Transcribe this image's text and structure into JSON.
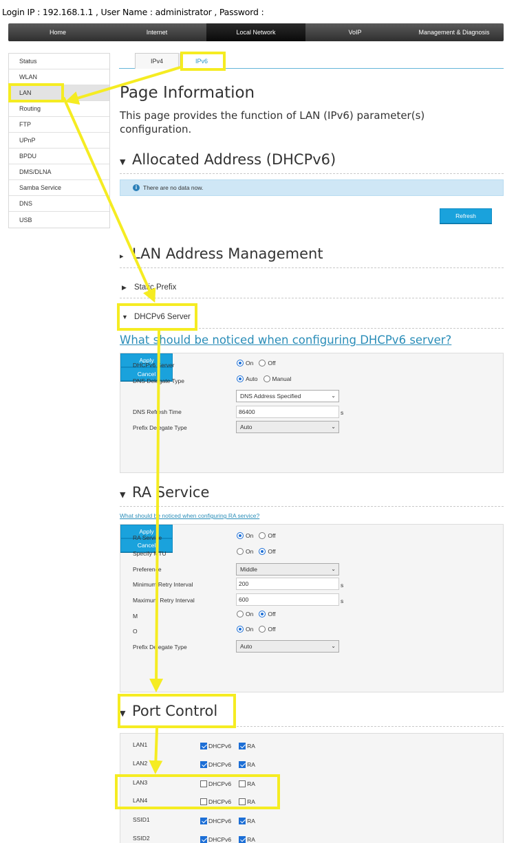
{
  "login_info": "Login IP : 192.168.1.1 ,  User Name : administrator , Password :",
  "topnav": [
    "Home",
    "Internet",
    "Local Network",
    "VoIP",
    "Management & Diagnosis"
  ],
  "topnav_active": "Local Network",
  "sidebar": [
    "Status",
    "WLAN",
    "LAN",
    "Routing",
    "FTP",
    "UPnP",
    "BPDU",
    "DMS/DLNA",
    "Samba Service",
    "DNS",
    "USB"
  ],
  "sidebar_active": "LAN",
  "tabs": [
    "IPv4",
    "IPv6"
  ],
  "tab_active": "IPv6",
  "page": {
    "title": "Page Information",
    "description": "This page provides the function of LAN (IPv6) parameter(s) configuration."
  },
  "allocated": {
    "title": "Allocated Address (DHCPv6)",
    "notice": "There are no data now.",
    "refresh": "Refresh"
  },
  "lan_mgmt": {
    "title": "LAN Address Management",
    "static_prefix": "Static Prefix",
    "dhcp_title": "DHCPv6 Server",
    "dhcp_link": "What should be noticed when configuring DHCPv6 server?"
  },
  "dhcp": {
    "server_label": "DHCPv6 Server",
    "server_value": "On",
    "dns_type_label": "DNS Delegate Type",
    "dns_type_options": [
      "Auto",
      "Manual"
    ],
    "dns_type_value": "Auto",
    "dns_select": "DNS Address Specified",
    "refresh_label": "DNS Refresh Time",
    "refresh_value": "86400",
    "refresh_unit": "s",
    "prefix_label": "Prefix Delegate Type",
    "prefix_value": "Auto",
    "apply": "Apply",
    "cancel": "Cancel"
  },
  "on_off": [
    "On",
    "Off"
  ],
  "ra": {
    "title": "RA Service",
    "link": "What should be noticed when configuring RA service?",
    "service_label": "RA Service",
    "service_value": "On",
    "mtu_label": "Specify MTU",
    "mtu_value": "Off",
    "pref_label": "Preference",
    "pref_value": "Middle",
    "min_label": "Minimum Retry Interval",
    "min_value": "200",
    "max_label": "Maximum Retry Interval",
    "max_value": "600",
    "unit": "s",
    "m_label": "M",
    "m_value": "Off",
    "o_label": "O",
    "o_value": "On",
    "prefix_label": "Prefix Delegate Type",
    "prefix_value": "Auto",
    "apply": "Apply",
    "cancel": "Cancel"
  },
  "port": {
    "title": "Port Control",
    "col1": "DHCPv6",
    "col2": "RA",
    "rows": [
      {
        "name": "LAN1",
        "dhcp": true,
        "ra": true
      },
      {
        "name": "LAN2",
        "dhcp": true,
        "ra": true
      },
      {
        "name": "LAN3",
        "dhcp": false,
        "ra": false
      },
      {
        "name": "LAN4",
        "dhcp": false,
        "ra": false
      },
      {
        "name": "SSID1",
        "dhcp": true,
        "ra": true
      },
      {
        "name": "SSID2",
        "dhcp": true,
        "ra": true
      }
    ]
  },
  "colors": {
    "accent": "#1aa2dc",
    "highlight": "#f5ec22",
    "link": "#2a8db8"
  }
}
